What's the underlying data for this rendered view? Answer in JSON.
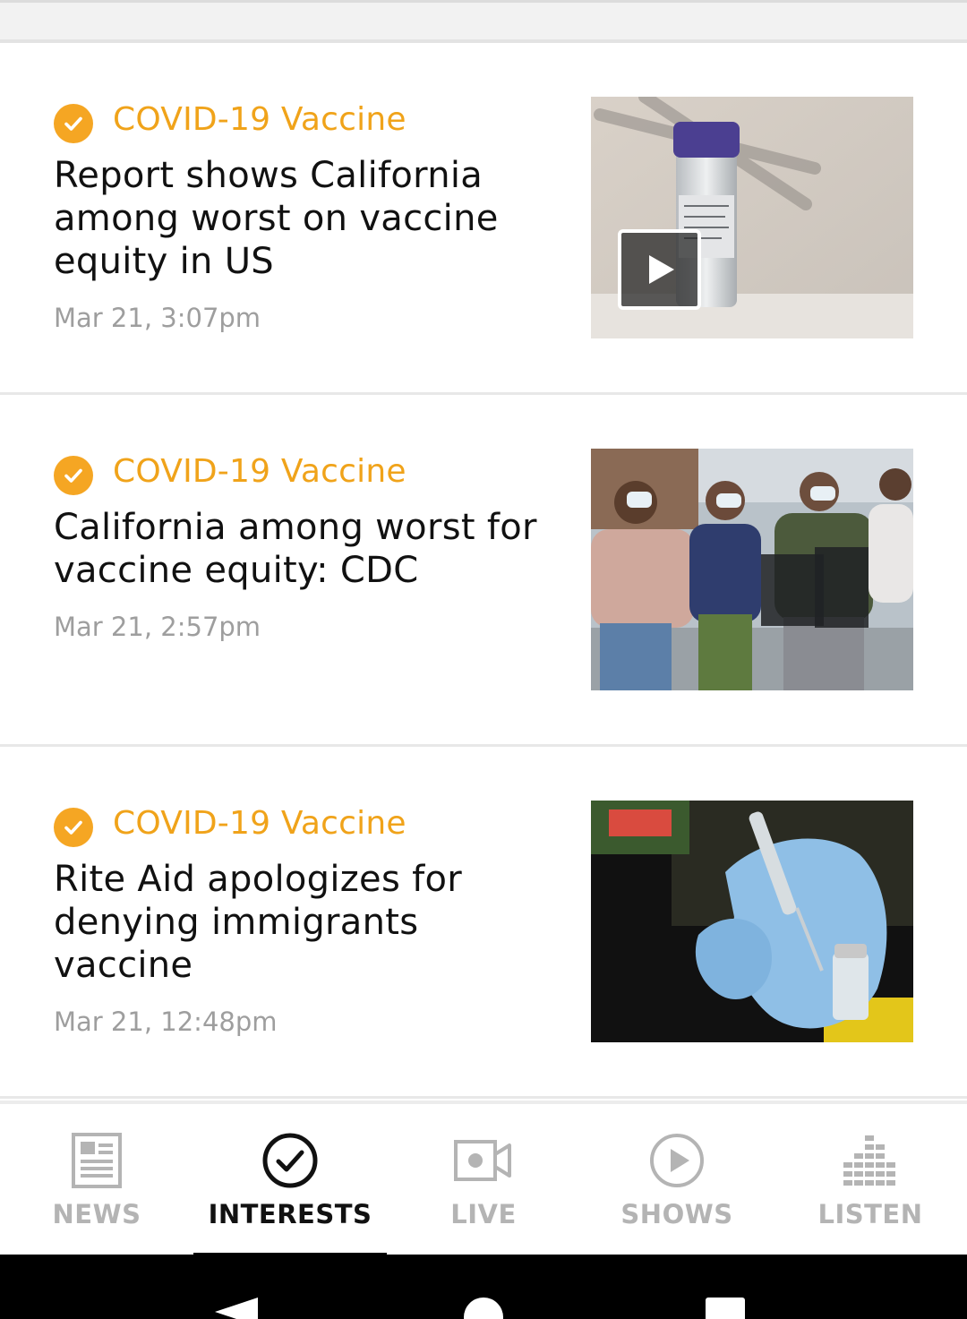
{
  "articles": [
    {
      "topic": "COVID-19 Vaccine",
      "headline": "Report shows California among worst on vaccine equity in US",
      "timestamp": "Mar 21, 3:07pm",
      "has_video": true
    },
    {
      "topic": "COVID-19 Vaccine",
      "headline": "California among worst for vaccine equity: CDC",
      "timestamp": "Mar 21, 2:57pm",
      "has_video": false
    },
    {
      "topic": "COVID-19 Vaccine",
      "headline": "Rite Aid apologizes for denying immigrants vaccine",
      "timestamp": "Mar 21, 12:48pm",
      "has_video": false
    }
  ],
  "tabs": {
    "news": "NEWS",
    "interests": "INTERESTS",
    "live": "LIVE",
    "shows": "SHOWS",
    "listen": "LISTEN",
    "active": "interests"
  },
  "colors": {
    "accent": "#f5a623",
    "topic_text": "#f0a31a",
    "headline": "#111111",
    "timestamp": "#9e9e9e",
    "tab_inactive": "#b4b4b4",
    "tab_active": "#111111"
  },
  "icons": {
    "topic_badge": "check-circle-icon",
    "video": "play-icon",
    "news": "newspaper-icon",
    "interests": "check-circle-outline-icon",
    "live": "video-camera-icon",
    "shows": "play-circle-icon",
    "listen": "equalizer-icon",
    "system_back": "back-triangle-icon",
    "system_home": "home-circle-icon",
    "system_recents": "recents-square-icon"
  }
}
